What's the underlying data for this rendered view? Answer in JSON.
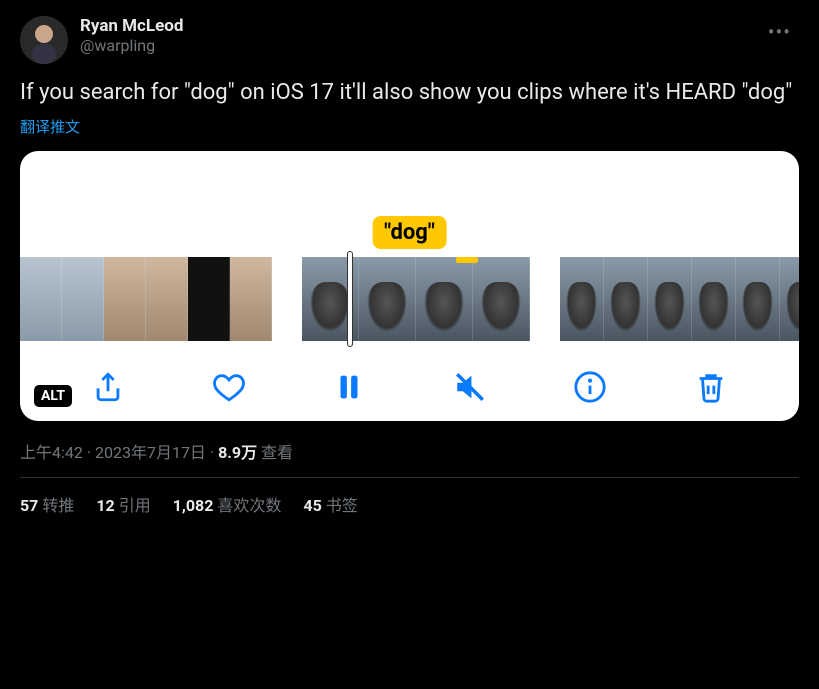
{
  "user": {
    "display_name": "Ryan McLeod",
    "handle": "@warpling"
  },
  "tweet_text": "If you search for \"dog\" on iOS 17 it'll also show you clips where it's HEARD \"dog\"",
  "translate_label": "翻译推文",
  "media": {
    "caption_pill": "\"dog\"",
    "alt_badge": "ALT"
  },
  "meta": {
    "time": "上午4:42",
    "dot1": " · ",
    "date": "2023年7月17日",
    "dot2": " · ",
    "views_value": "8.9万",
    "views_label": " 查看"
  },
  "stats": {
    "retweets_num": "57",
    "retweets_label": "转推",
    "quotes_num": "12",
    "quotes_label": "引用",
    "likes_num": "1,082",
    "likes_label": "喜欢次数",
    "bookmarks_num": "45",
    "bookmarks_label": "书签"
  }
}
